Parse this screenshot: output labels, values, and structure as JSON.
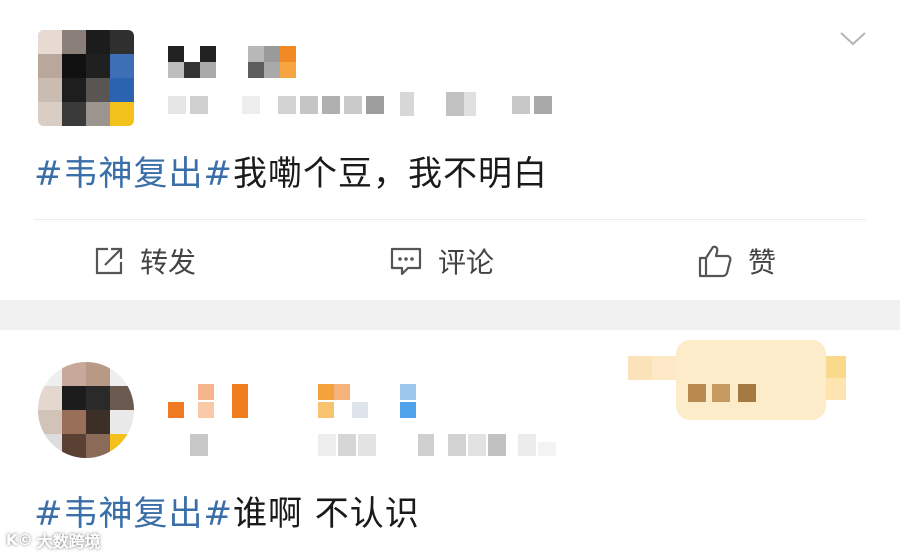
{
  "post1": {
    "text_tag": "#韦神复出#",
    "text_body": "我嘞个豆，我不明白",
    "actions": {
      "repost_label": "转发",
      "comment_label": "评论",
      "like_label": "赞"
    }
  },
  "post2": {
    "text_tag": "#韦神复出#",
    "text_body": "谁啊 不认识"
  },
  "watermark": {
    "logo": "K©",
    "text": "大数跨境"
  },
  "colors": {
    "accent": "#3a6ea8",
    "text": "#1a1a1a",
    "icon": "#444444",
    "separator": "#f1f1f1"
  },
  "icons": [
    "chevron-down-icon",
    "repost-icon",
    "comment-icon",
    "like-icon"
  ]
}
